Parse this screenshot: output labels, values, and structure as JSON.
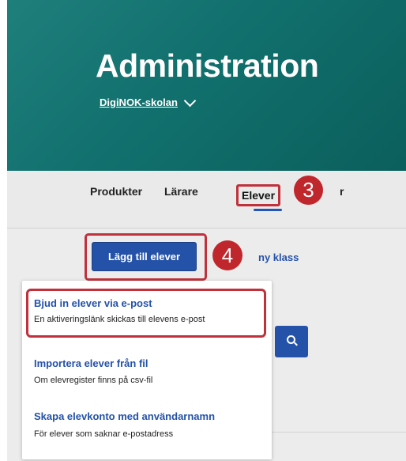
{
  "header": {
    "title": "Administration",
    "school_name": "DigiNOK-skolan"
  },
  "nav": {
    "items": [
      "Produkter",
      "Lärare",
      "Elever",
      "r"
    ]
  },
  "actions": {
    "add_students": "Lägg till elever",
    "new_class": "ny klass"
  },
  "dropdown": {
    "options": [
      {
        "title": "Bjud in elever via e-post",
        "description": "En aktiveringslänk skickas till elevens e-post"
      },
      {
        "title": "Importera elever från fil",
        "description": "Om elevregister finns på csv-fil"
      },
      {
        "title": "Skapa elevkonto med användarnamn",
        "description": "För elever som saknar e-postadress"
      }
    ]
  },
  "annotations": {
    "step_3": "3",
    "step_4": "4"
  },
  "colors": {
    "header_teal": "#11706d",
    "primary_blue": "#2452a8",
    "highlight_red": "#c0313c"
  }
}
